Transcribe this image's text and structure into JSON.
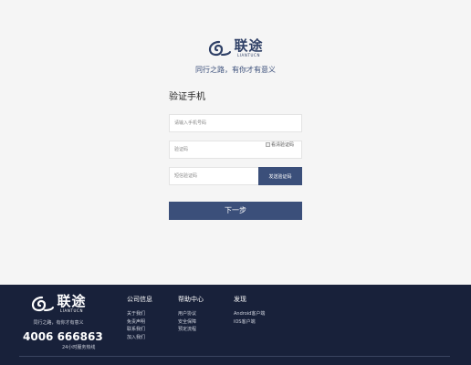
{
  "brand": {
    "name_cn": "联途",
    "name_en": "LIANTUCN",
    "slogan": "同行之路，有你才有意义"
  },
  "form": {
    "title": "验证手机",
    "phone_placeholder": "请输入手机号码",
    "captcha_placeholder": "验证码",
    "captcha_alt": "看清验证码",
    "sms_placeholder": "短信验证码",
    "send_label": "发送验证码",
    "next_label": "下一步"
  },
  "footer": {
    "slogan": "同行之路，有你才有意义",
    "phone": "4006 666863",
    "phone_sub": "24小时服务热线",
    "columns": [
      {
        "title": "公司信息",
        "links": [
          "关于我们",
          "免责声明",
          "联系我们",
          "加入我们"
        ]
      },
      {
        "title": "帮助中心",
        "links": [
          "用户协议",
          "安全保障",
          "预定流程"
        ]
      },
      {
        "title": "发现",
        "links": [
          "Android客户端",
          "IOS客户端"
        ]
      }
    ]
  },
  "colors": {
    "brand_navy": "#3b4f7a",
    "footer_bg": "#18213a",
    "page_bg": "#f5f5f5"
  }
}
